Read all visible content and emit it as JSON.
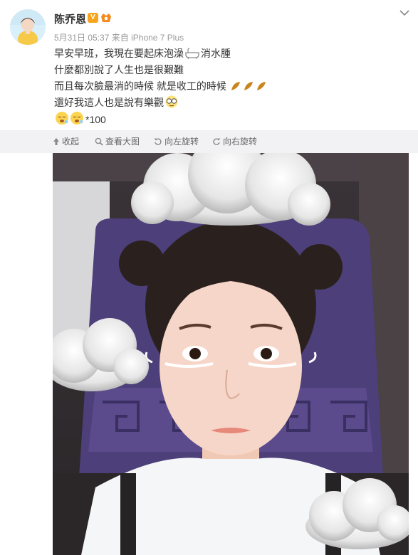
{
  "user": {
    "name": "陈乔恩",
    "verified_badge": "V"
  },
  "meta": {
    "date": "5月31日 05:37",
    "source_prefix": "来自",
    "source": "iPhone 7 Plus"
  },
  "post": {
    "line1a": "早安早班，我現在要起床泡澡",
    "line1b": "消水腫",
    "line2": "什麼都別說了人生也是很艱難",
    "line3": "而且每次臉最消的時候 就是收工的時候",
    "line4": "還好我這人也是說有樂觀",
    "line5": "*100"
  },
  "toolbar": {
    "collapse": "收起",
    "view_large": "查看大图",
    "rotate_left": "向左旋转",
    "rotate_right": "向右旋转"
  },
  "icons": {
    "chevron": "chevron-down-icon",
    "collapse": "arrow-up-icon",
    "view_large": "magnifier-icon",
    "rotate_left": "rotate-left-icon",
    "rotate_right": "rotate-right-icon"
  },
  "colors": {
    "badge_orange": "#f7a31c",
    "toolbar_bg": "#f2f2f5",
    "meta_gray": "#999999"
  }
}
